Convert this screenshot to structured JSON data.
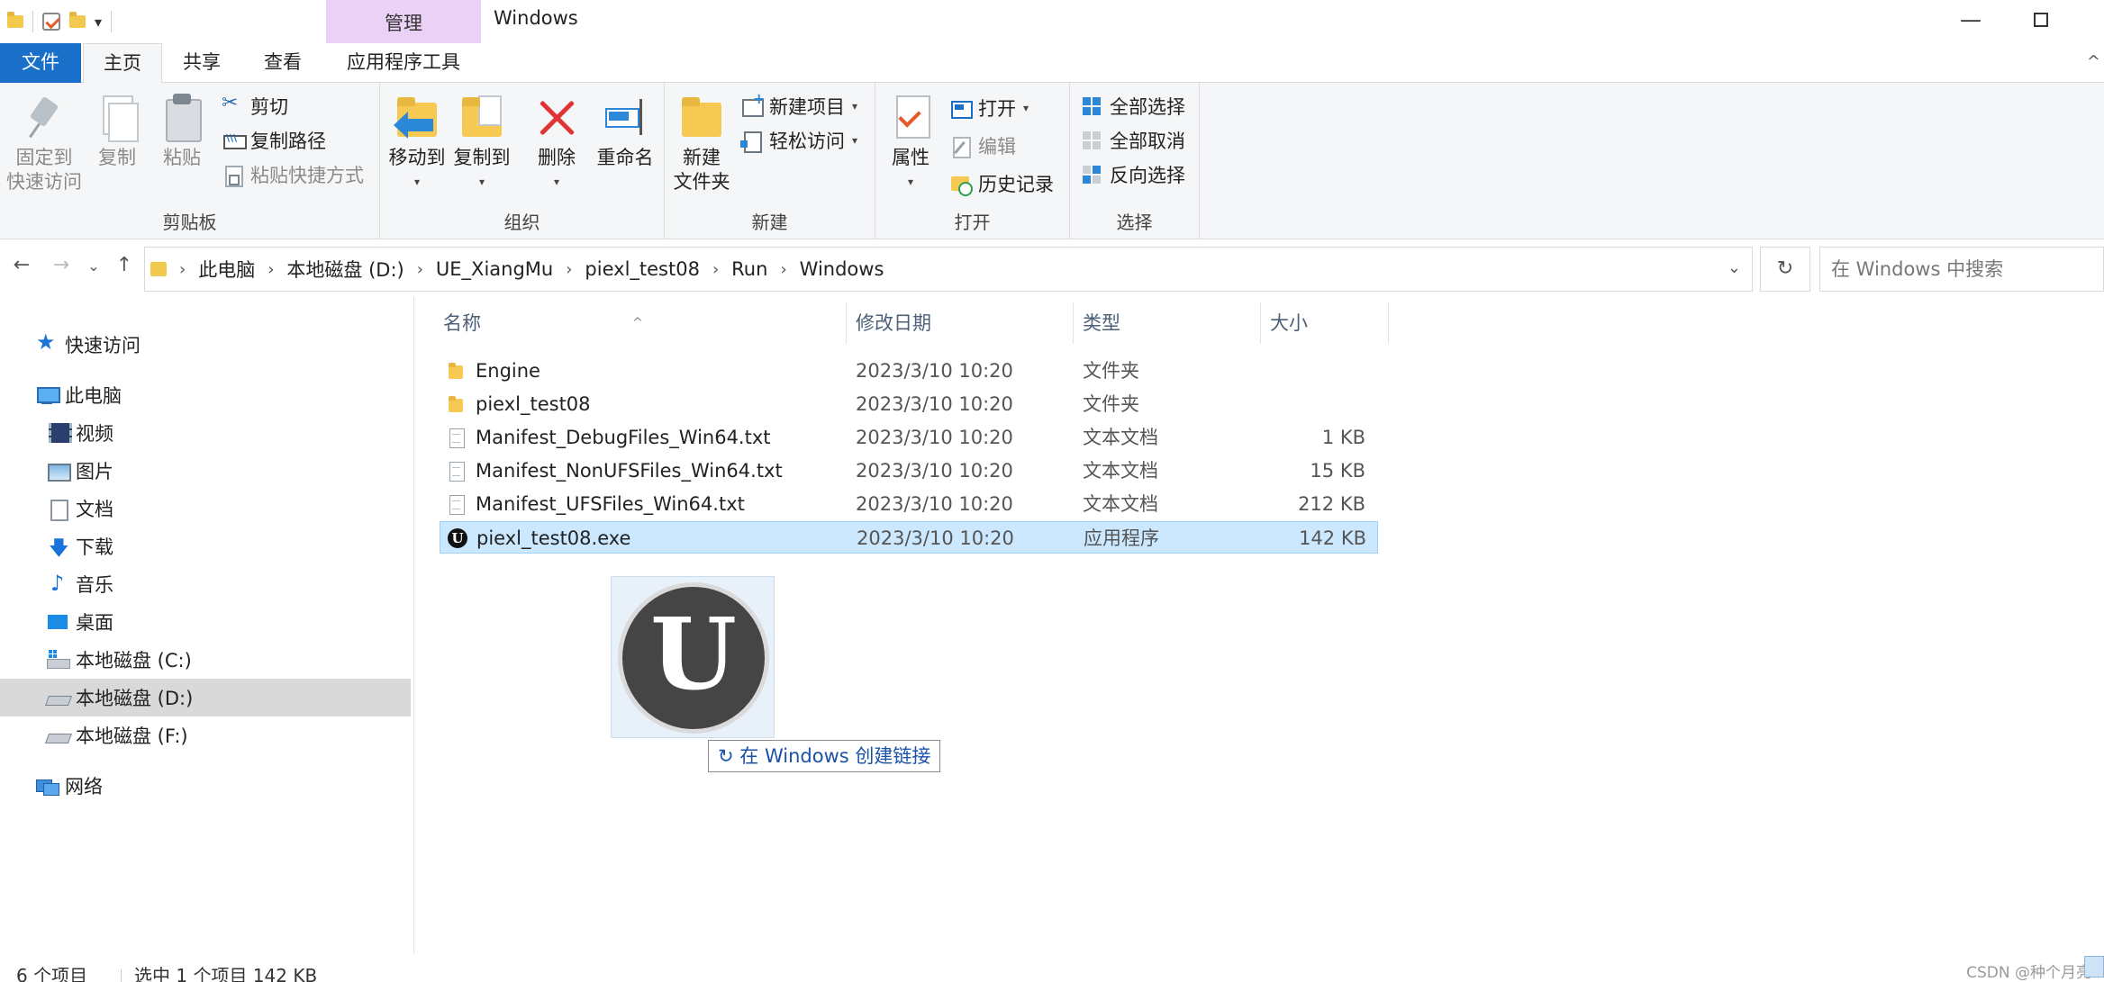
{
  "window": {
    "title": "Windows",
    "contextual_tab_group": "管理",
    "min_symbol": "—",
    "close_symbol": ""
  },
  "ribbon_tabs": {
    "file": "文件",
    "home": "主页",
    "share": "共享",
    "view": "查看",
    "app_tools": "应用程序工具",
    "collapse_symbol": "^"
  },
  "ribbon": {
    "clipboard": {
      "label": "剪贴板",
      "pin_line1": "固定到",
      "pin_line2": "快速访问",
      "copy": "复制",
      "paste": "粘贴",
      "cut": "剪切",
      "copy_path": "复制路径",
      "paste_shortcut": "粘贴快捷方式"
    },
    "organize": {
      "label": "组织",
      "move_to": "移动到",
      "copy_to": "复制到",
      "delete": "删除",
      "rename": "重命名"
    },
    "new": {
      "label": "新建",
      "new_folder_line1": "新建",
      "new_folder_line2": "文件夹",
      "new_item": "新建项目",
      "easy_access": "轻松访问"
    },
    "open": {
      "label": "打开",
      "properties": "属性",
      "open": "打开",
      "edit": "编辑",
      "history": "历史记录"
    },
    "select": {
      "label": "选择",
      "select_all": "全部选择",
      "select_none": "全部取消",
      "invert": "反向选择"
    }
  },
  "nav": {
    "back": "←",
    "forward": "→",
    "recent": "⌄",
    "up": "↑",
    "refresh": "↻"
  },
  "address": {
    "crumbs": [
      "此电脑",
      "本地磁盘 (D:)",
      "UE_XiangMu",
      "piexl_test08",
      "Run",
      "Windows"
    ],
    "dropdown": "⌄"
  },
  "search": {
    "placeholder": "在 Windows 中搜索"
  },
  "navpane": {
    "quick_access": "快速访问",
    "this_pc": "此电脑",
    "videos": "视频",
    "pictures": "图片",
    "documents": "文档",
    "downloads": "下载",
    "music": "音乐",
    "desktop": "桌面",
    "drive_c": "本地磁盘 (C:)",
    "drive_d": "本地磁盘 (D:)",
    "drive_f": "本地磁盘 (F:)",
    "network": "网络"
  },
  "columns": {
    "name": "名称",
    "modified": "修改日期",
    "type": "类型",
    "size": "大小",
    "sort_symbol": "^"
  },
  "files": [
    {
      "name": "Engine",
      "date": "2023/3/10 10:20",
      "type": "文件夹",
      "size": "",
      "icon": "folder-icon"
    },
    {
      "name": "piexl_test08",
      "date": "2023/3/10 10:20",
      "type": "文件夹",
      "size": "",
      "icon": "folder-icon"
    },
    {
      "name": "Manifest_DebugFiles_Win64.txt",
      "date": "2023/3/10 10:20",
      "type": "文本文档",
      "size": "1 KB",
      "icon": "text-file-icon"
    },
    {
      "name": "Manifest_NonUFSFiles_Win64.txt",
      "date": "2023/3/10 10:20",
      "type": "文本文档",
      "size": "15 KB",
      "icon": "text-file-icon"
    },
    {
      "name": "Manifest_UFSFiles_Win64.txt",
      "date": "2023/3/10 10:20",
      "type": "文本文档",
      "size": "212 KB",
      "icon": "text-file-icon"
    },
    {
      "name": "piexl_test08.exe",
      "date": "2023/3/10 10:20",
      "type": "应用程序",
      "size": "142 KB",
      "icon": "unreal-engine-icon"
    }
  ],
  "drag": {
    "tooltip_prefix": "↻",
    "tooltip": "在 Windows 创建链接"
  },
  "status": {
    "count": "6 个项目",
    "selection": "选中 1 个项目  142 KB",
    "watermark": "CSDN @种个月亮"
  },
  "colors": {
    "file_tab": "#1a6fc9",
    "contextual_tab": "#ebd1f5",
    "selection": "#cce8ff",
    "nav_selected": "#d9d9d9"
  }
}
